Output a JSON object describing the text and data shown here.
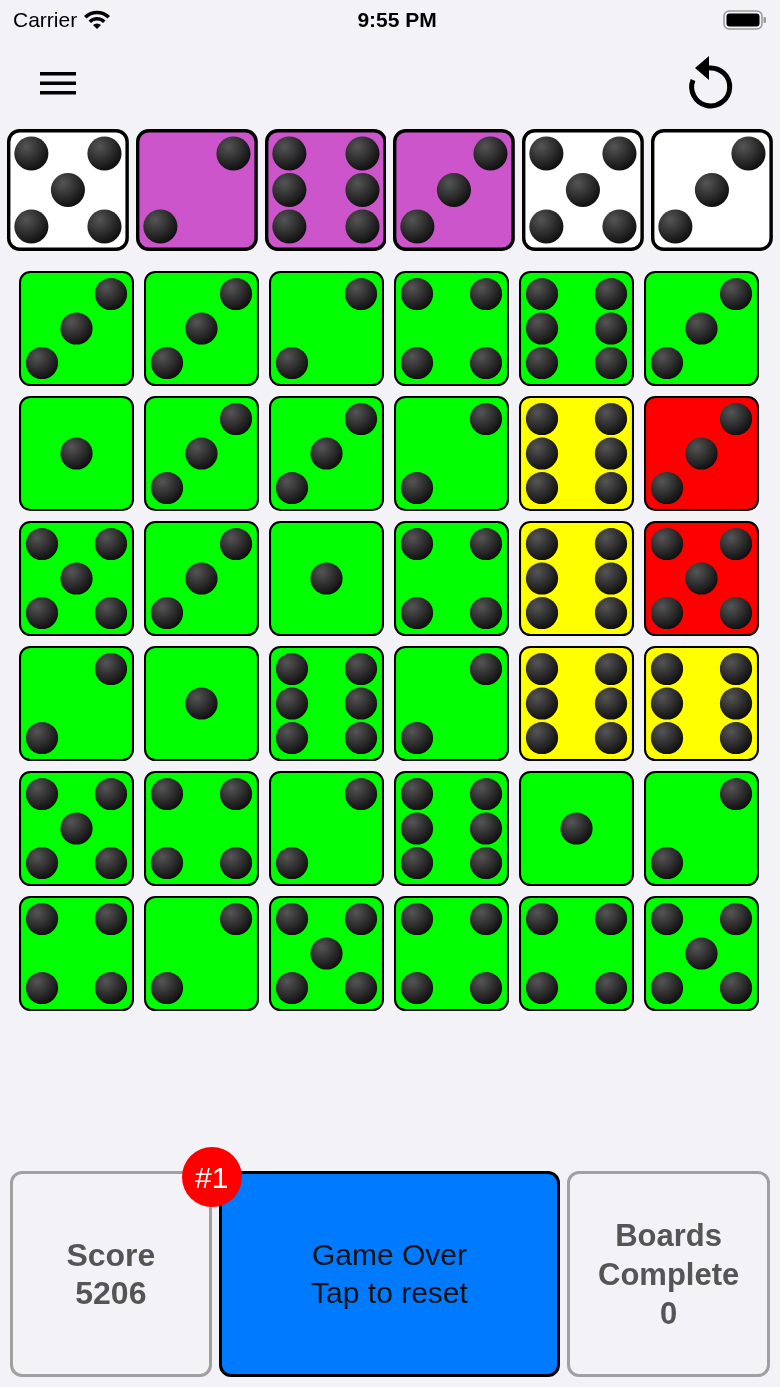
{
  "status_bar": {
    "carrier": "Carrier",
    "time": "9:55 PM"
  },
  "tray": [
    {
      "kind": "five",
      "color": "#ffffff"
    },
    {
      "kind": "two",
      "color": "#cc55cc"
    },
    {
      "kind": "six",
      "color": "#cc55cc"
    },
    {
      "kind": "three",
      "color": "#cc55cc"
    },
    {
      "kind": "five",
      "color": "#ffffff"
    },
    {
      "kind": "three",
      "color": "#ffffff"
    }
  ],
  "grid": [
    {
      "dice": [
        {
          "kind": "three",
          "color": "#00ff00"
        },
        {
          "kind": "three",
          "color": "#00ff00"
        },
        {
          "kind": "two",
          "color": "#00ff00"
        },
        {
          "kind": "four",
          "color": "#00ff00"
        },
        {
          "kind": "six",
          "color": "#00ff00"
        },
        {
          "kind": "three",
          "color": "#00ff00"
        }
      ]
    },
    {
      "dice": [
        {
          "kind": "one",
          "color": "#00ff00"
        },
        {
          "kind": "three",
          "color": "#00ff00"
        },
        {
          "kind": "three",
          "color": "#00ff00"
        },
        {
          "kind": "two",
          "color": "#00ff00"
        },
        {
          "kind": "six",
          "color": "#ffff00"
        },
        {
          "kind": "three",
          "color": "#ff0000"
        }
      ]
    },
    {
      "dice": [
        {
          "kind": "five",
          "color": "#00ff00"
        },
        {
          "kind": "three",
          "color": "#00ff00"
        },
        {
          "kind": "one",
          "color": "#00ff00"
        },
        {
          "kind": "four",
          "color": "#00ff00"
        },
        {
          "kind": "six",
          "color": "#ffff00"
        },
        {
          "kind": "five",
          "color": "#ff0000"
        }
      ]
    },
    {
      "dice": [
        {
          "kind": "two",
          "color": "#00ff00"
        },
        {
          "kind": "one",
          "color": "#00ff00"
        },
        {
          "kind": "six",
          "color": "#00ff00"
        },
        {
          "kind": "two",
          "color": "#00ff00"
        },
        {
          "kind": "six",
          "color": "#ffff00"
        },
        {
          "kind": "six",
          "color": "#ffff00"
        }
      ]
    },
    {
      "dice": [
        {
          "kind": "five",
          "color": "#00ff00"
        },
        {
          "kind": "four",
          "color": "#00ff00"
        },
        {
          "kind": "two",
          "color": "#00ff00"
        },
        {
          "kind": "six",
          "color": "#00ff00"
        },
        {
          "kind": "one",
          "color": "#00ff00"
        },
        {
          "kind": "two",
          "color": "#00ff00"
        }
      ]
    },
    {
      "dice": [
        {
          "kind": "four",
          "color": "#00ff00"
        },
        {
          "kind": "two",
          "color": "#00ff00"
        },
        {
          "kind": "five",
          "color": "#00ff00"
        },
        {
          "kind": "four",
          "color": "#00ff00"
        },
        {
          "kind": "four",
          "color": "#00ff00"
        },
        {
          "kind": "five",
          "color": "#00ff00"
        }
      ]
    }
  ],
  "score": {
    "label": "Score",
    "value": "5206",
    "badge": "#1"
  },
  "game_button": {
    "lines": [
      "Game Over",
      "Tap to reset"
    ]
  },
  "boards": {
    "label": "Boards Complete",
    "value": "0"
  }
}
